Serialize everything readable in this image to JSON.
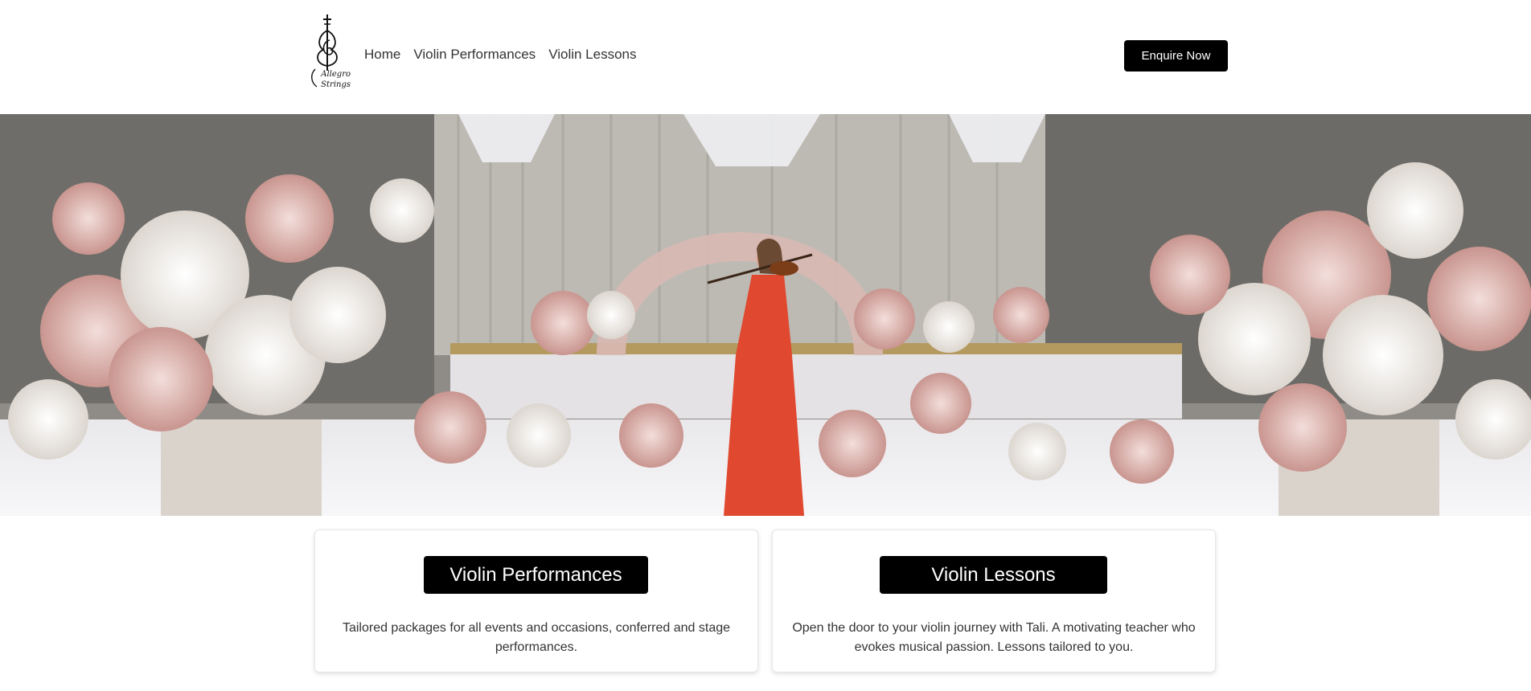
{
  "brand": {
    "logo_text_line1": "Allegro",
    "logo_text_line2": "Strings",
    "logo_icon": "violin-treble-clef-icon"
  },
  "nav": {
    "items": [
      {
        "label": "Home"
      },
      {
        "label": "Violin Performances"
      },
      {
        "label": "Violin Lessons"
      }
    ]
  },
  "header": {
    "cta_label": "Enquire Now"
  },
  "hero": {
    "image_subject": "violinist-in-floral-venue-photo"
  },
  "cards": [
    {
      "button_label": "Violin Performances",
      "description": "Tailored packages for all events and occasions, conferred and stage performances."
    },
    {
      "button_label": "Violin Lessons",
      "description": "Open the door to your violin journey with Tali. A motivating teacher who evokes musical passion. Lessons tailored to you."
    }
  ],
  "colors": {
    "primary_button": "#000000",
    "button_text": "#ffffff",
    "body_text": "#333333",
    "dress": "#e0482f"
  }
}
